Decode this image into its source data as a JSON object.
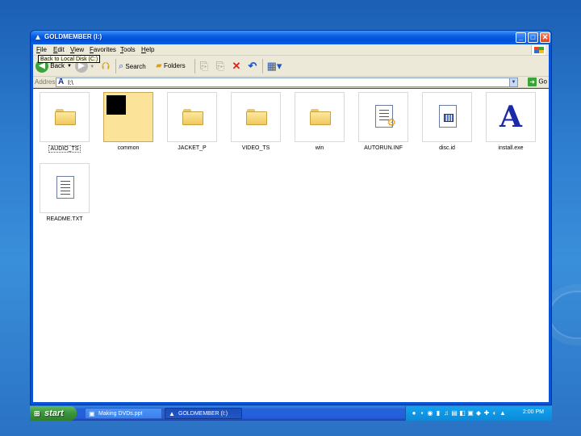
{
  "window": {
    "title": "GOLDMEMBER (I:)",
    "title_icon": "install-app-icon",
    "controls": [
      "minimize",
      "maximize",
      "close"
    ]
  },
  "menu": {
    "items": [
      "File",
      "Edit",
      "View",
      "Favorites",
      "Tools",
      "Help"
    ]
  },
  "toolbar": {
    "back_label": "Back",
    "search_label": "Search",
    "folders_label": "Folders"
  },
  "address": {
    "label": "Address",
    "value": "I:\\",
    "go_label": "Go"
  },
  "tooltip": "Back to Local Disk (C:)",
  "files": [
    {
      "name": "AUDIO_TS",
      "type": "folder"
    },
    {
      "name": "common",
      "type": "folder"
    },
    {
      "name": "JACKET_P",
      "type": "folder"
    },
    {
      "name": "VIDEO_TS",
      "type": "folder"
    },
    {
      "name": "win",
      "type": "folder"
    },
    {
      "name": "AUTORUN.INF",
      "type": "config-file"
    },
    {
      "name": "disc.id",
      "type": "system-file"
    },
    {
      "name": "install.exe",
      "type": "application"
    },
    {
      "name": "README.TXT",
      "type": "text-file"
    }
  ],
  "taskbar": {
    "start_label": "start",
    "tasks": [
      {
        "label": "Making DVDs.ppt",
        "icon": "powerpoint-icon"
      },
      {
        "label": "GOLDMEMBER (I:)",
        "icon": "install-app-icon"
      }
    ],
    "clock": "2:00 PM"
  },
  "colors": {
    "desktop": "#2f7fd0",
    "titlebar": "#0a5de0",
    "chrome": "#ece9d8",
    "selection": "#fbe39a",
    "start": "#3a943a"
  }
}
